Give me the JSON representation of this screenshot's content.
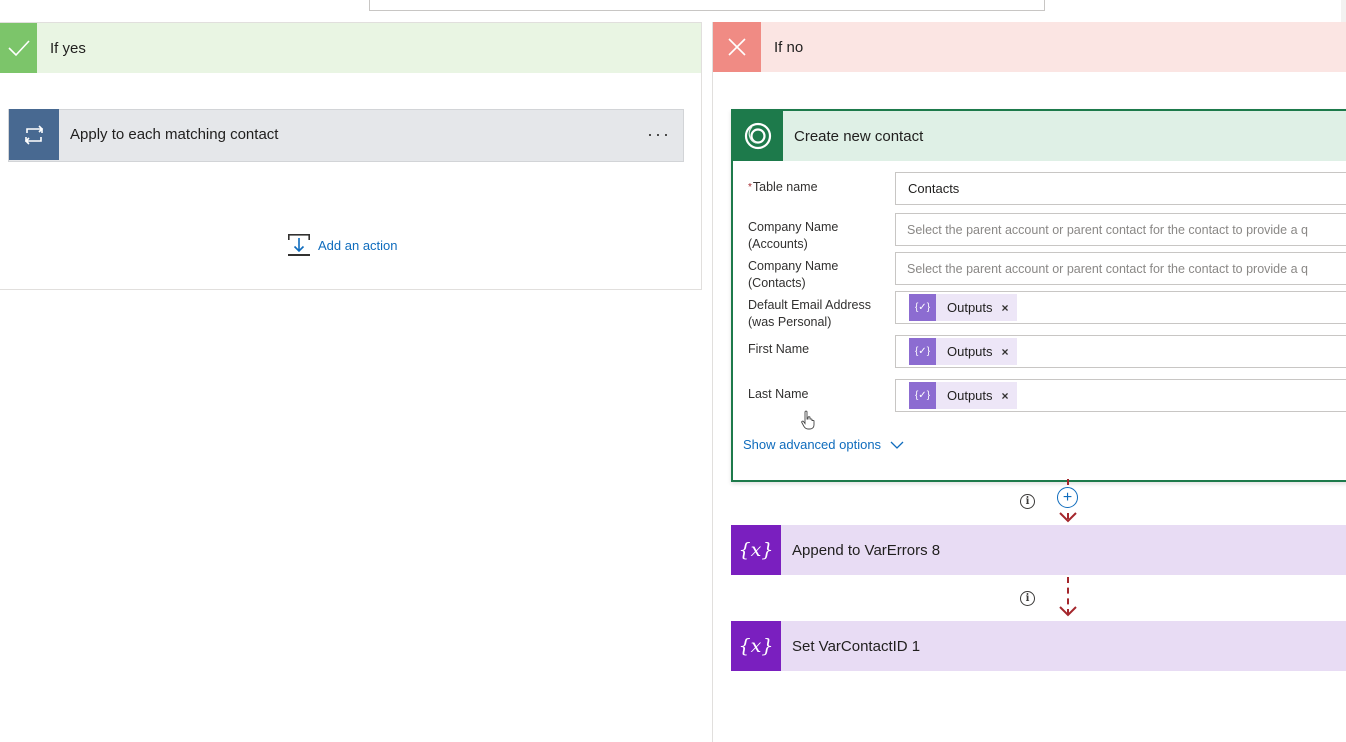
{
  "branches": {
    "yes": {
      "title": "If yes"
    },
    "no": {
      "title": "If no"
    }
  },
  "apply_each": {
    "title": "Apply to each matching contact",
    "menu_label": "···"
  },
  "add_action": {
    "label": "Add an action"
  },
  "create_contact": {
    "title": "Create new contact",
    "fields": [
      {
        "label": "Table name",
        "required_mark": "*",
        "value": "Contacts"
      },
      {
        "label": "Company Name (Accounts)",
        "placeholder": "Select the parent account or parent contact for the contact to provide a q"
      },
      {
        "label": "Company Name (Contacts)",
        "placeholder": "Select the parent account or parent contact for the contact to provide a q"
      },
      {
        "label": "Default Email Address (was Personal)",
        "token": "Outputs"
      },
      {
        "label": "First Name",
        "token": "Outputs"
      },
      {
        "label": "Last Name",
        "token": "Outputs"
      }
    ],
    "advanced_label": "Show advanced options"
  },
  "token_icon_text": "{✓}",
  "token_remove": "×",
  "info_glyph": "i",
  "plus_glyph": "+",
  "var_icon_text": "{x}",
  "steps": [
    {
      "title": "Append to VarErrors 8"
    },
    {
      "title": "Set VarContactID 1"
    }
  ],
  "colors": {
    "yes_accent": "#7cc56a",
    "no_accent": "#f08b84",
    "dataverse_green": "#1d7a4b",
    "variable_purple": "#7a1fbf",
    "loop_blue": "#486991",
    "link_blue": "#0f6cbd"
  }
}
